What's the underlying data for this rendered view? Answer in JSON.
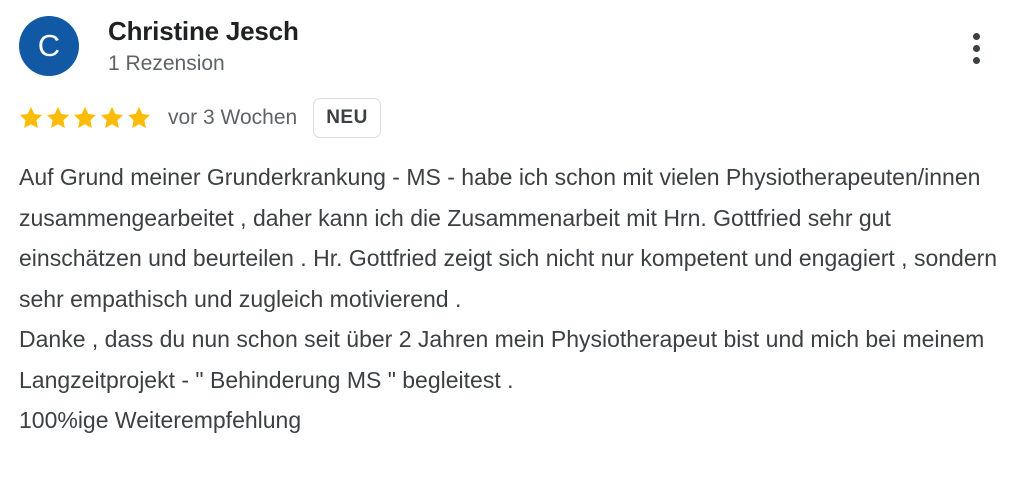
{
  "reviewer": {
    "avatar_letter": "C",
    "avatar_color": "#1259a5",
    "name": "Christine Jesch",
    "review_count": "1 Rezension"
  },
  "more_options_icon": "more-vert-icon",
  "rating": {
    "stars": 5,
    "max_stars": 5,
    "star_color": "#fbbc04",
    "date": "vor 3 Wochen",
    "badge": "NEU"
  },
  "review": {
    "paragraphs": [
      "Auf Grund meiner Grunderkrankung - MS - habe ich schon mit vielen Physiotherapeuten/innen zusammengearbeitet , daher kann ich die Zusammenarbeit mit Hrn. Gottfried sehr gut einschätzen und beurteilen . Hr. Gottfried zeigt sich nicht nur kompetent und engagiert , sondern sehr empathisch und zugleich motivierend .",
      "Danke , dass du nun schon seit über 2 Jahren mein Physiotherapeut bist und mich bei meinem Langzeitprojekt - \" Behinderung MS \" begleitest .",
      "100%ige Weiterempfehlung"
    ]
  }
}
